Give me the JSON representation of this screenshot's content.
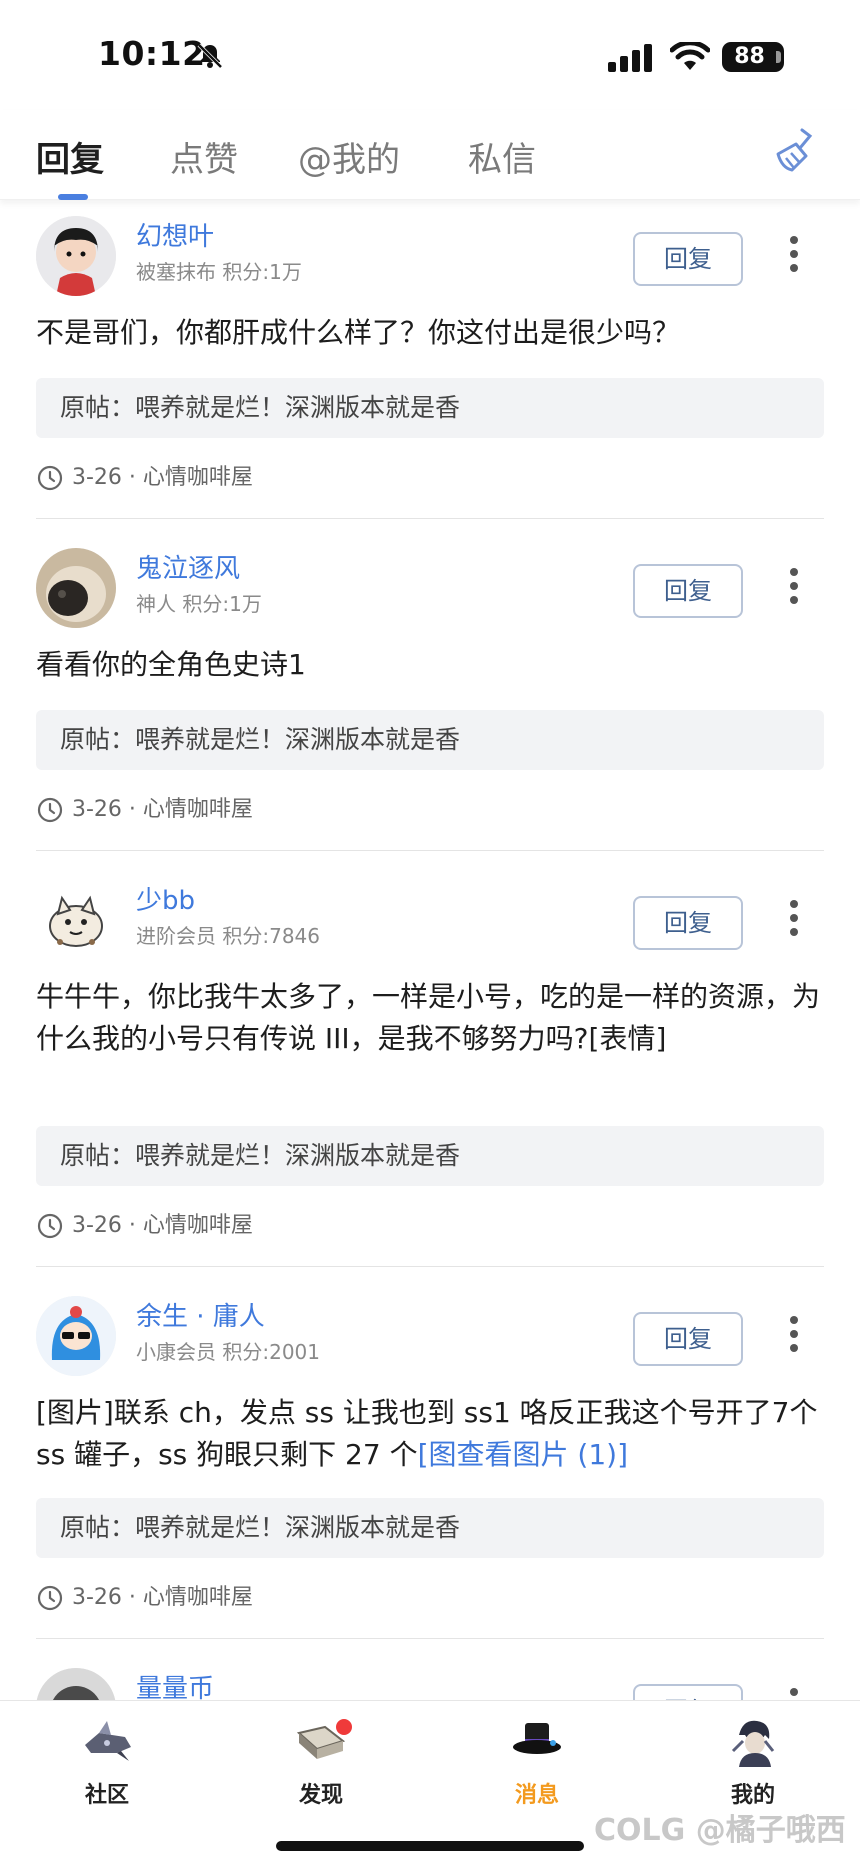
{
  "status_bar": {
    "time": "10:12",
    "battery": "88"
  },
  "tabs": [
    {
      "label": "回复",
      "active": true
    },
    {
      "label": "点赞",
      "active": false
    },
    {
      "label": "@我的",
      "active": false
    },
    {
      "label": "私信",
      "active": false
    }
  ],
  "colors": {
    "accent": "#3f79dc",
    "active_nav": "#f39a1e",
    "badge": "#ef3a3a"
  },
  "reply_label": "回复",
  "quote_prefix": "原帖：",
  "items": [
    {
      "username": "幻想叶",
      "meta": "被塞抹布 积分:1万",
      "content": "不是哥们，你都肝成什么样了？你这付出是很少吗？",
      "quote": "原帖：喂养就是烂！深渊版本就是香",
      "footer": "3-26 · 心情咖啡屋"
    },
    {
      "username": "鬼泣逐风",
      "meta": "神人 积分:1万",
      "content": "看看你的全角色史诗1",
      "quote": "原帖：喂养就是烂！深渊版本就是香",
      "footer": "3-26 · 心情咖啡屋"
    },
    {
      "username": "少bb",
      "meta": "进阶会员 积分:7846",
      "content": "牛牛牛，你比我牛太多了，一样是小号，吃的是一样的资源，为什么我的小号只有传说 III，是我不够努力吗?[表情]",
      "quote": "原帖：喂养就是烂！深渊版本就是香",
      "footer": "3-26 · 心情咖啡屋"
    },
    {
      "username": "余生 · 庸人",
      "meta": "小康会员 积分:2001",
      "content": "[图片]联系 ch，发点 ss 让我也到 ss1 咯反正我这个号开了7个 ss 罐子，ss 狗眼只剩下 27 个",
      "content_link": "[图查看图片 (1)]",
      "quote": "原帖：喂养就是烂！深渊版本就是香",
      "footer": "3-26 · 心情咖啡屋"
    },
    {
      "username": "量量币"
    }
  ],
  "bottom_nav": [
    {
      "label": "社区",
      "icon": "ship-icon",
      "active": false
    },
    {
      "label": "发现",
      "icon": "book-icon",
      "active": false,
      "badge": true
    },
    {
      "label": "消息",
      "icon": "hat-icon",
      "active": true
    },
    {
      "label": "我的",
      "icon": "character-icon",
      "active": false
    }
  ],
  "watermark": "COLG @橘子哦西"
}
